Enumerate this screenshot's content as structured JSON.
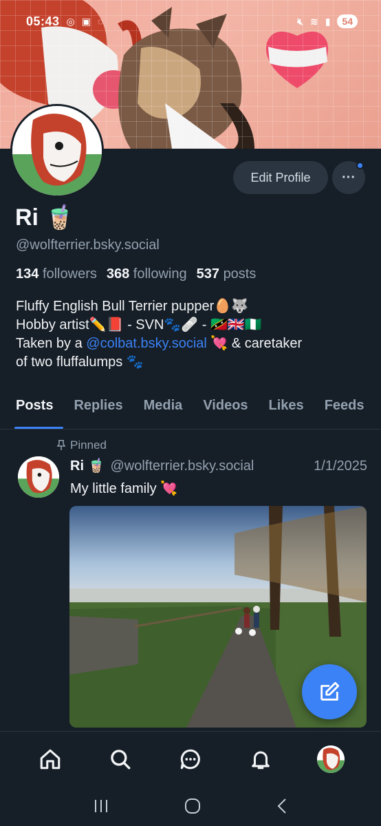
{
  "status_bar": {
    "time": "05:43",
    "battery": "54"
  },
  "profile": {
    "name": "Ri 🧋",
    "handle": "@wolfterrier.bsky.social",
    "edit_label": "Edit Profile",
    "more_label": "···",
    "stats": {
      "followers_count": "134",
      "followers_label": "followers",
      "following_count": "368",
      "following_label": "following",
      "posts_count": "537",
      "posts_label": "posts"
    },
    "bio": {
      "line1": "Fluffy English Bull Terrier pupper🥚🐺",
      "line2": "Hobby artist✏️📕 - SVN🐾🩹 - 🇰🇳🇬🇧🇳🇬",
      "line3_pre": "Taken by a ",
      "line3_link": "@colbat.bsky.social",
      "line3_post": " 💘 & caretaker",
      "line4": "of two fluffalumps 🐾"
    }
  },
  "tabs": [
    {
      "label": "Posts",
      "active": true
    },
    {
      "label": "Replies"
    },
    {
      "label": "Media"
    },
    {
      "label": "Videos"
    },
    {
      "label": "Likes"
    },
    {
      "label": "Feeds"
    }
  ],
  "post": {
    "pinned_label": "Pinned",
    "author_name": "Ri 🧋",
    "author_handle": "@wolfterrier.bsky.social",
    "date": "1/1/2025",
    "text": "My little family 💘"
  },
  "colors": {
    "accent": "#3b82f6",
    "background": "#161e27",
    "muted": "#93a1b0"
  },
  "icons": {
    "bottom_nav": [
      "home-icon",
      "search-icon",
      "chat-icon",
      "bell-icon",
      "profile-avatar"
    ],
    "fab": "compose-icon"
  }
}
